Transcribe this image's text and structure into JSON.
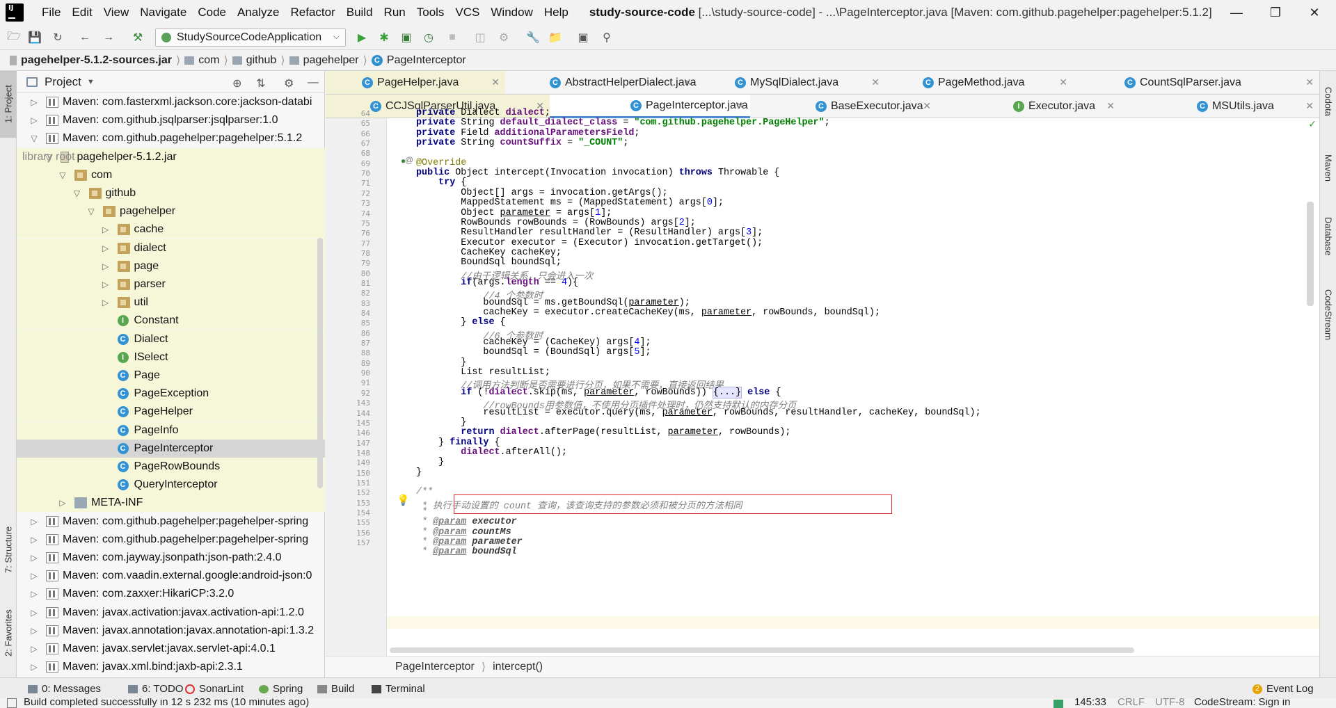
{
  "menubar": {
    "items": [
      "File",
      "Edit",
      "View",
      "Navigate",
      "Code",
      "Analyze",
      "Refactor",
      "Build",
      "Run",
      "Tools",
      "VCS",
      "Window",
      "Help"
    ],
    "project_name": "study-source-code",
    "title_rest": " [...\\study-source-code] - ...\\PageInterceptor.java [Maven: com.github.pagehelper:pagehelper:5.1.2]"
  },
  "toolbar": {
    "run_config": "StudySourceCodeApplication"
  },
  "navbar": {
    "crumbs": [
      "pagehelper-5.1.2-sources.jar",
      "com",
      "github",
      "pagehelper",
      "PageInterceptor"
    ]
  },
  "left_strip": {
    "project_tab": "1: Project",
    "structure_tab": "7: Structure",
    "favorites_tab": "2: Favorites"
  },
  "project_panel": {
    "title": "Project",
    "tree": [
      {
        "label": "Maven: com.fasterxml.jackson.core:jackson-databi",
        "suffix": ""
      },
      {
        "label": "Maven: com.github.jsqlparser:jsqlparser:1.0",
        "suffix": ""
      },
      {
        "label": "Maven: com.github.pagehelper:pagehelper:5.1.2",
        "suffix": ""
      },
      {
        "label": "pagehelper-5.1.2.jar",
        "suffix": "library root"
      },
      {
        "label": "com",
        "suffix": ""
      },
      {
        "label": "github",
        "suffix": ""
      },
      {
        "label": "pagehelper",
        "suffix": ""
      },
      {
        "label": "cache",
        "suffix": ""
      },
      {
        "label": "dialect",
        "suffix": ""
      },
      {
        "label": "page",
        "suffix": ""
      },
      {
        "label": "parser",
        "suffix": ""
      },
      {
        "label": "util",
        "suffix": ""
      },
      {
        "label": "Constant",
        "suffix": ""
      },
      {
        "label": "Dialect",
        "suffix": ""
      },
      {
        "label": "ISelect",
        "suffix": ""
      },
      {
        "label": "Page",
        "suffix": ""
      },
      {
        "label": "PageException",
        "suffix": ""
      },
      {
        "label": "PageHelper",
        "suffix": ""
      },
      {
        "label": "PageInfo",
        "suffix": ""
      },
      {
        "label": "PageInterceptor",
        "suffix": ""
      },
      {
        "label": "PageRowBounds",
        "suffix": ""
      },
      {
        "label": "QueryInterceptor",
        "suffix": ""
      },
      {
        "label": "META-INF",
        "suffix": ""
      },
      {
        "label": "Maven: com.github.pagehelper:pagehelper-spring",
        "suffix": ""
      },
      {
        "label": "Maven: com.github.pagehelper:pagehelper-spring",
        "suffix": ""
      },
      {
        "label": "Maven: com.jayway.jsonpath:json-path:2.4.0",
        "suffix": ""
      },
      {
        "label": "Maven: com.vaadin.external.google:android-json:0",
        "suffix": ""
      },
      {
        "label": "Maven: com.zaxxer:HikariCP:3.2.0",
        "suffix": ""
      },
      {
        "label": "Maven: javax.activation:javax.activation-api:1.2.0",
        "suffix": ""
      },
      {
        "label": "Maven: javax.annotation:javax.annotation-api:1.3.2",
        "suffix": ""
      },
      {
        "label": "Maven: javax.servlet:javax.servlet-api:4.0.1",
        "suffix": ""
      },
      {
        "label": "Maven: javax.xml.bind:jaxb-api:2.3.1",
        "suffix": ""
      }
    ]
  },
  "tabs": [
    "PageHelper.java",
    "AbstractHelperDialect.java",
    "MySqlDialect.java",
    "PageMethod.java",
    "CountSqlParser.java",
    "CCJSqlParserUtil.java",
    "PageInterceptor.java",
    "BaseExecutor.java",
    "Executor.java",
    "MSUtils.java"
  ],
  "editor": {
    "line_numbers": [
      "64",
      "65",
      "66",
      "67",
      "68",
      "69",
      "70",
      "71",
      "72",
      "73",
      "74",
      "75",
      "76",
      "77",
      "78",
      "79",
      "80",
      "81",
      "82",
      "83",
      "84",
      "85",
      "86",
      "87",
      "88",
      "89",
      "90",
      "91",
      "92",
      "143",
      "144",
      "145",
      "146",
      "147",
      "148",
      "149",
      "150",
      "151",
      "152",
      "153",
      "154",
      "155",
      "156",
      "157"
    ],
    "breadcrumb_class": "PageInterceptor",
    "breadcrumb_method": "intercept()"
  },
  "right_strip": {
    "tabs": [
      "Codota",
      "Maven",
      "Database",
      "CodeStream"
    ]
  },
  "bottom_tools": {
    "messages": "0: Messages",
    "todo": "6: TODO",
    "sonarlint": "SonarLint",
    "spring": "Spring",
    "build": "Build",
    "terminal": "Terminal",
    "event_log": "Event Log",
    "event_count": "2"
  },
  "statusbar": {
    "message": "Build completed successfully in 12 s 232 ms (10 minutes ago)",
    "position": "145:33",
    "line_sep": "CRLF",
    "encoding": "UTF-8",
    "codestream": "CodeStream: Sign in"
  }
}
